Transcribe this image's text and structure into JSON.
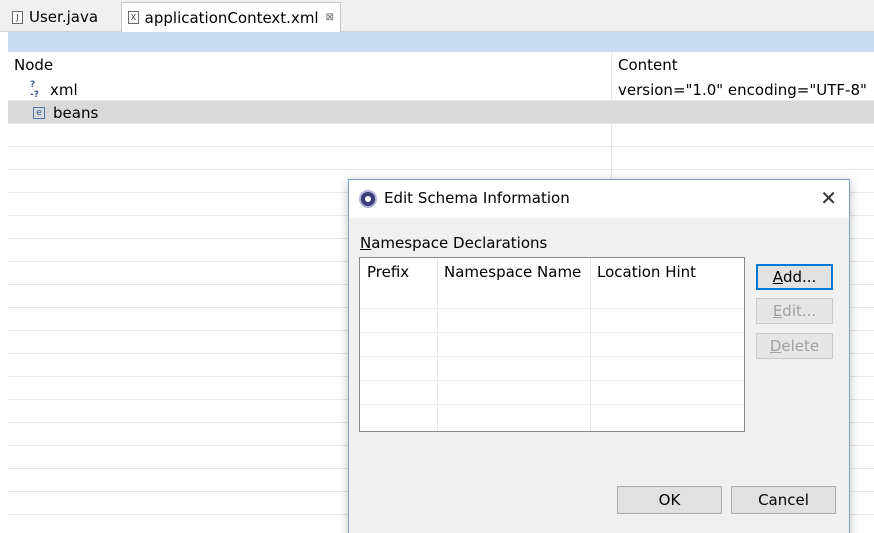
{
  "tabs": [
    {
      "label": "User.java",
      "icon": "java-file-icon",
      "icon_glyph": "J"
    },
    {
      "label": "applicationContext.xml",
      "icon": "xml-file-icon",
      "icon_glyph": "X",
      "close_glyph": "⊠"
    }
  ],
  "tree": {
    "columns": {
      "node": "Node",
      "content": "Content"
    },
    "rows": [
      {
        "icon_glyph": "?-?",
        "node": "xml",
        "content": "version=\"1.0\" encoding=\"UTF-8\""
      },
      {
        "icon_glyph": "e",
        "node": "beans",
        "content": ""
      }
    ]
  },
  "dialog": {
    "title": "Edit Schema Information",
    "close_glyph": "✕",
    "section_mnemonic": "N",
    "section_rest": "amespace Declarations",
    "table": {
      "columns": [
        "Prefix",
        "Namespace Name",
        "Location Hint"
      ]
    },
    "buttons": {
      "add": {
        "mnemonic": "A",
        "rest": "dd..."
      },
      "edit": {
        "mnemonic": "E",
        "rest": "dit..."
      },
      "delete": {
        "mnemonic": "D",
        "rest": "elete"
      },
      "ok": "OK",
      "cancel": "Cancel"
    }
  },
  "colors": {
    "accent": "#0078d7",
    "selection": "#d9d9d9",
    "header_strip": "#c7dcf2"
  }
}
